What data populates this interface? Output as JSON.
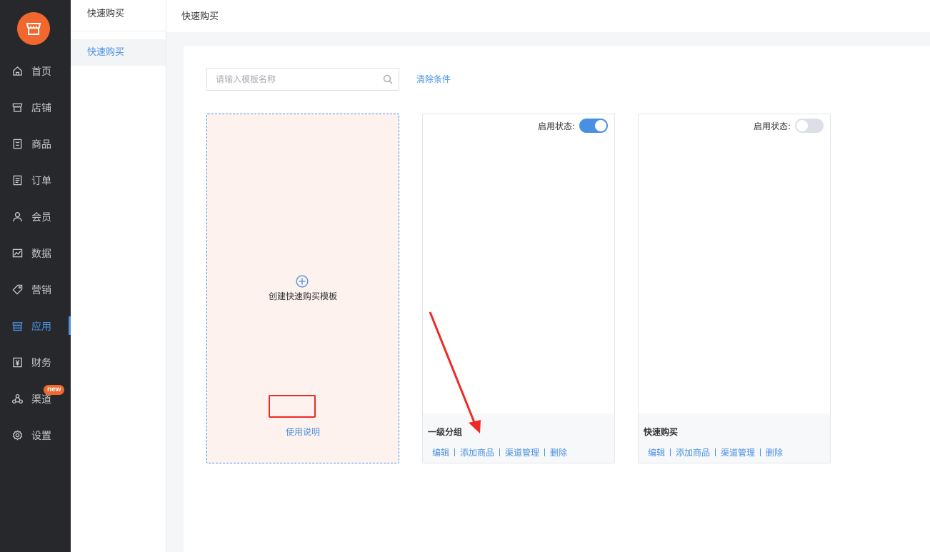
{
  "nav": {
    "items": [
      {
        "label": "首页",
        "icon": "home-icon"
      },
      {
        "label": "店铺",
        "icon": "store-icon"
      },
      {
        "label": "商品",
        "icon": "product-icon"
      },
      {
        "label": "订单",
        "icon": "order-icon"
      },
      {
        "label": "会员",
        "icon": "member-icon"
      },
      {
        "label": "数据",
        "icon": "chart-icon"
      },
      {
        "label": "营销",
        "icon": "tag-icon"
      },
      {
        "label": "应用",
        "icon": "app-icon",
        "active": true
      },
      {
        "label": "财务",
        "icon": "yen-icon"
      },
      {
        "label": "渠道",
        "icon": "channel-icon",
        "badge": "new"
      },
      {
        "label": "设置",
        "icon": "gear-icon"
      }
    ]
  },
  "subnav": {
    "title": "快速购买",
    "active_item": "快速购买"
  },
  "header": {
    "breadcrumb": "快速购买"
  },
  "search": {
    "placeholder": "请输入模板名称",
    "value": "",
    "clear_label": "清除条件"
  },
  "create_card": {
    "label": "创建快速购买模板",
    "help_label": "使用说明"
  },
  "templates": [
    {
      "status_label": "启用状态:",
      "enabled": true,
      "name": "一级分组",
      "actions": [
        "编辑",
        "添加商品",
        "渠道管理",
        "删除"
      ]
    },
    {
      "status_label": "启用状态:",
      "enabled": false,
      "name": "快速购买",
      "actions": [
        "编辑",
        "添加商品",
        "渠道管理",
        "删除"
      ]
    }
  ],
  "colors": {
    "accent": "#4a90e2",
    "brand": "#f2672e",
    "annotation": "#ee2a24",
    "nav_bg": "#27282c"
  }
}
